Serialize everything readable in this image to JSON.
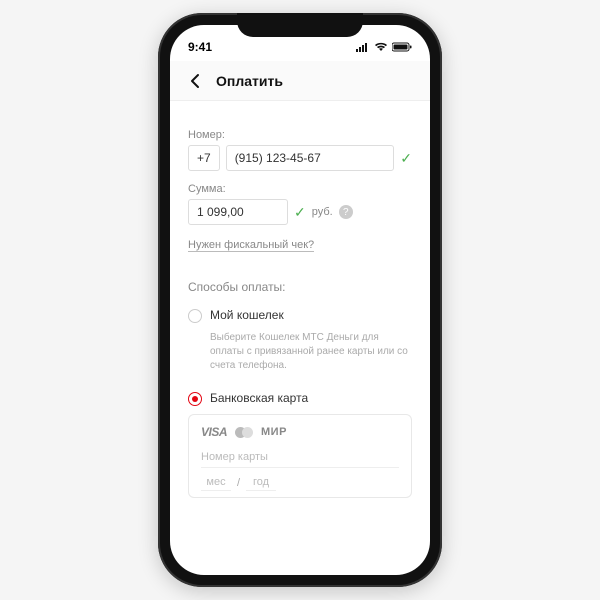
{
  "status": {
    "time": "9:41"
  },
  "nav": {
    "title": "Оплатить"
  },
  "form": {
    "number_label": "Номер:",
    "prefix": "+7",
    "phone": "(915) 123-45-67",
    "amount_label": "Сумма:",
    "amount": "1 099,00",
    "currency": "руб.",
    "fiscal_link": "Нужен фискальный чек?",
    "help": "?"
  },
  "payment": {
    "title": "Способы оплаты:",
    "wallet_label": "Мой кошелек",
    "wallet_desc": "Выберите Кошелек МТС Деньги для оплаты с привязанной ранее карты или со счета телефона.",
    "card_label": "Банковская карта",
    "visa": "VISA",
    "mir": "МИР",
    "card_placeholder": "Номер карты",
    "mm": "мес",
    "sep": "/",
    "yy": "год"
  }
}
